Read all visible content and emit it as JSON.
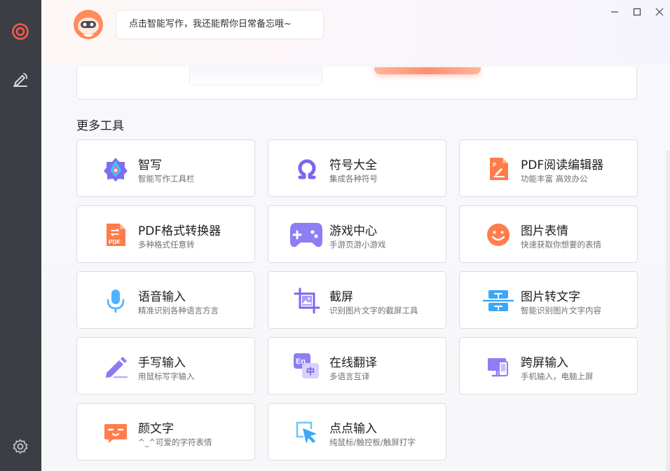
{
  "header": {
    "bubble_text": "点击智能写作，我还能帮你日常备忘哦~"
  },
  "section": {
    "title": "更多工具"
  },
  "tools": [
    {
      "title": "智写",
      "desc": "智能写作工具栏",
      "icon": "smart-write-icon"
    },
    {
      "title": "符号大全",
      "desc": "集成各种符号",
      "icon": "omega-symbol-icon"
    },
    {
      "title": "PDF阅读编辑器",
      "desc": "功能丰富 高效办公",
      "icon": "pdf-edit-icon"
    },
    {
      "title": "PDF格式转换器",
      "desc": "多种格式任意转",
      "icon": "pdf-convert-icon"
    },
    {
      "title": "游戏中心",
      "desc": "手游页游小游戏",
      "icon": "gamepad-icon"
    },
    {
      "title": "图片表情",
      "desc": "快速获取你想要的表情",
      "icon": "smiley-icon"
    },
    {
      "title": "语音输入",
      "desc": "精准识别各种语言方言",
      "icon": "microphone-icon"
    },
    {
      "title": "截屏",
      "desc": "识别图片文字的截屏工具",
      "icon": "screenshot-icon"
    },
    {
      "title": "图片转文字",
      "desc": "智能识别图片文字内容",
      "icon": "image-to-text-icon"
    },
    {
      "title": "手写输入",
      "desc": "用鼠标写字输入",
      "icon": "pen-icon"
    },
    {
      "title": "在线翻译",
      "desc": "多语言互译",
      "icon": "translate-icon"
    },
    {
      "title": "跨屏输入",
      "desc": "手机输入，电脑上屏",
      "icon": "cross-screen-icon"
    },
    {
      "title": "颜文字",
      "desc": "^_^可爱的字符表情",
      "icon": "kaomoji-icon"
    },
    {
      "title": "点点输入",
      "desc": "纯鼠标/触控板/触屏打字",
      "icon": "cursor-click-icon"
    }
  ],
  "colors": {
    "sidebar_bg": "#3b3e45",
    "accent_orange": "#ff6a4a",
    "accent_purple": "#8b7cf6"
  }
}
